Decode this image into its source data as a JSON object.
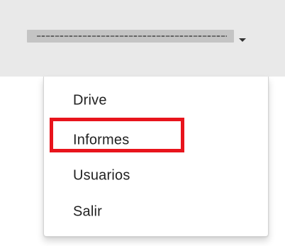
{
  "header": {
    "account_name_redacted": true,
    "caret_icon": "chevron-down-icon"
  },
  "menu": {
    "items": [
      {
        "label": "Drive"
      },
      {
        "label": "Informes",
        "highlighted": true
      },
      {
        "label": "Usuarios"
      },
      {
        "label": "Salir"
      }
    ]
  },
  "colors": {
    "header_background": "#e9e9e9",
    "menu_background": "#ffffff",
    "highlight": "#e8141c",
    "text": "#222222"
  }
}
